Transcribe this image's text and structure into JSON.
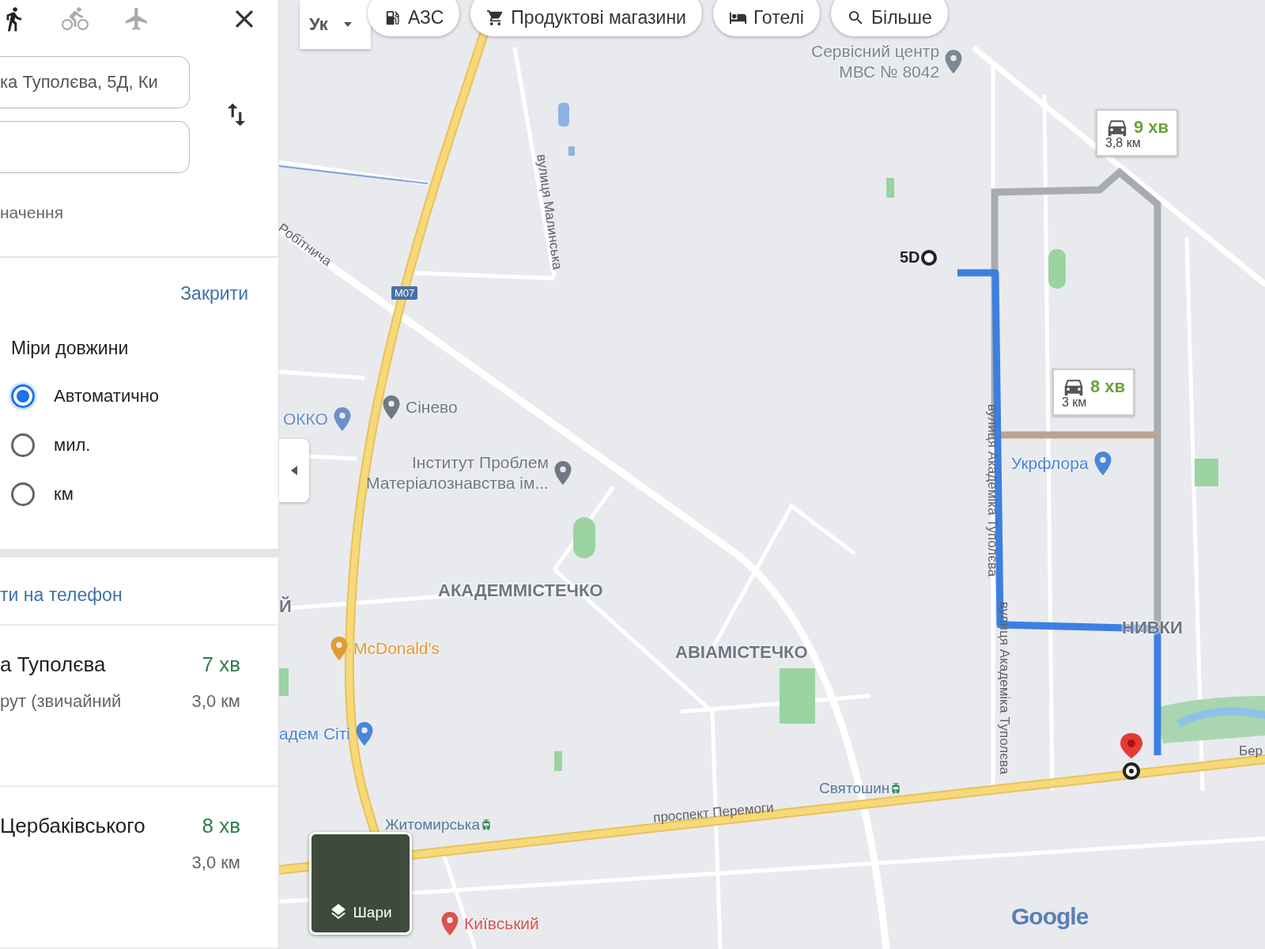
{
  "directions_panel": {
    "travel_modes": [
      {
        "kind": "walk",
        "selected": true
      },
      {
        "kind": "bike",
        "selected": false
      },
      {
        "kind": "flight",
        "selected": false
      }
    ],
    "origin_field": {
      "value": "ка Туполєва, 5Д, Ки"
    },
    "hint_text": "начення",
    "options": {
      "close_link": "Закрити",
      "title": "Міри довжини",
      "units": [
        {
          "label": "Автоматично",
          "selected": true
        },
        {
          "label": "мил.",
          "selected": false
        },
        {
          "label": "км",
          "selected": false
        }
      ]
    },
    "send_link": "ти на телефон",
    "routes": [
      {
        "name": "а Туполєва",
        "time": "7 хв",
        "detail": "рут (звичайний",
        "distance": "3,0 км"
      },
      {
        "name": "Цербаківського",
        "time": "8 хв",
        "distance": "3,0 км"
      }
    ]
  },
  "map": {
    "input_tool": {
      "value": "Ук"
    },
    "chips": [
      {
        "kind": "fuel",
        "label": "АЗС"
      },
      {
        "kind": "cart",
        "label": "Продуктові магазини"
      },
      {
        "kind": "bed",
        "label": "Готелі"
      },
      {
        "kind": "search",
        "label": "Більше"
      }
    ],
    "places": [
      {
        "lines": [
          "Сервісний центр",
          "МВС № 8042"
        ],
        "color": "#7c8794"
      },
      {
        "lines": [
          "ОККО"
        ],
        "color": "#6b8fc9"
      },
      {
        "lines": [
          "Сінево"
        ],
        "color": "#6f7884"
      },
      {
        "lines": [
          "Інститут Проблем",
          "Матеріалознавства ім..."
        ],
        "color": "#6f7884"
      },
      {
        "lines": [
          "Укрфлора"
        ],
        "color": "#4a86d8"
      },
      {
        "lines": [
          "McDonald's"
        ],
        "color": "#e39b32"
      },
      {
        "lines": [
          "адем Сіті"
        ],
        "color": "#4a86d8"
      },
      {
        "lines": [
          "Київський"
        ],
        "color": "#d9534f"
      }
    ],
    "districts": [
      "АКАДЕММІСТЕЧКО",
      "АВІАМІСТЕЧКО",
      "НИВКИ",
      "Й"
    ],
    "streets": [
      "вулиця Малинська",
      "Робітнича",
      "вулиця Академіка Туполєва",
      "вулиця Академіка Туполєва",
      "проспект Перемоги",
      "Бер"
    ],
    "stations": [
      "Житомирська",
      "Святошин"
    ],
    "road_badge": "М07",
    "start_label": "5D",
    "route_callouts": [
      {
        "time": "9 хв",
        "distance": "3,8 км"
      },
      {
        "time": "8 хв",
        "distance": "3 км"
      }
    ],
    "layers_button": "Шари",
    "logo": "Google"
  }
}
